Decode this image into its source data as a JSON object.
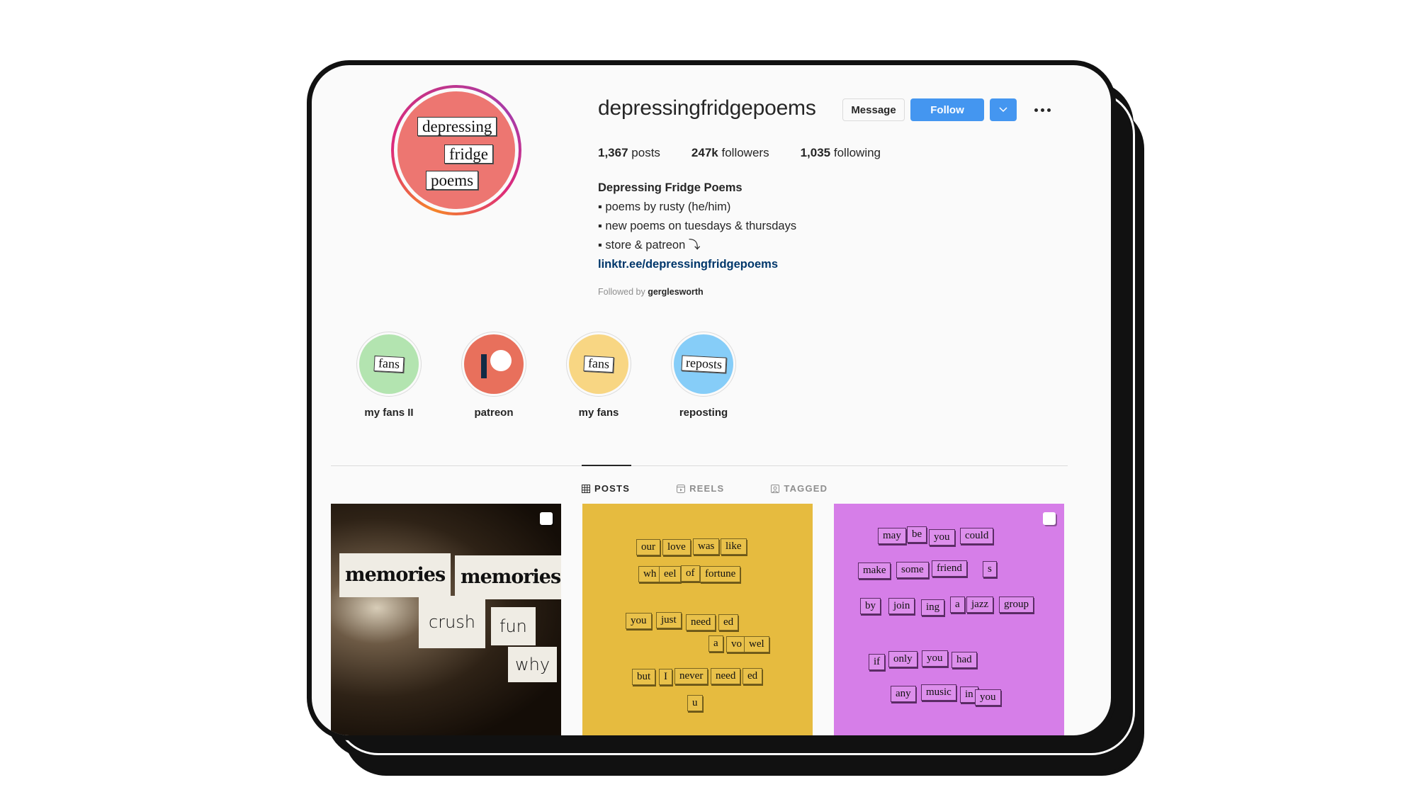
{
  "profile": {
    "username": "depressingfridgepoems",
    "avatar_words": [
      "depressing",
      "fridge",
      "poems"
    ],
    "buttons": {
      "message": "Message",
      "follow": "Follow",
      "dropdown_icon": "chevron-down",
      "more_icon": "more-horizontal"
    },
    "stats": {
      "posts_count": "1,367",
      "posts_label": "posts",
      "followers_count": "247k",
      "followers_label": "followers",
      "following_count": "1,035",
      "following_label": "following"
    },
    "bio": {
      "name": "Depressing Fridge Poems",
      "lines": [
        "▪ poems by rusty (he/him)",
        "▪ new poems on tuesdays & thursdays",
        "▪ store & patreon ⤵"
      ],
      "link": "linktr.ee/depressingfridgepoems"
    },
    "followed_by": {
      "prefix": "Followed by",
      "user": "gerglesworth"
    }
  },
  "highlights": [
    {
      "label": "my fans II",
      "word": "fans",
      "color": "#b3e4b0"
    },
    {
      "label": "patreon",
      "word": "",
      "color": "#e8705c"
    },
    {
      "label": "my fans",
      "word": "fans",
      "color": "#f8d683"
    },
    {
      "label": "reposting",
      "word": "reposts",
      "color": "#86cdf8"
    }
  ],
  "tabs": [
    {
      "label": "POSTS",
      "icon": "grid",
      "active": true
    },
    {
      "label": "REELS",
      "icon": "reels",
      "active": false
    },
    {
      "label": "TAGGED",
      "icon": "tagged",
      "active": false
    }
  ],
  "posts": [
    {
      "multi": true,
      "words": [
        "memories",
        "memories",
        "crush",
        "fun",
        "why"
      ]
    },
    {
      "multi": false,
      "words": [
        "our",
        "love",
        "was",
        "like",
        "wh",
        "eel",
        "of",
        "fortune",
        "you",
        "just",
        "need",
        "ed",
        "a",
        "vo",
        "wel",
        "but",
        "I",
        "never",
        "need",
        "ed",
        "u"
      ]
    },
    {
      "multi": true,
      "words": [
        "may",
        "be",
        "you",
        "could",
        "make",
        "some",
        "friend",
        "s",
        "by",
        "join",
        "ing",
        "a",
        "jazz",
        "group",
        "if",
        "only",
        "you",
        "had",
        "any",
        "music",
        "in",
        "you"
      ]
    }
  ]
}
